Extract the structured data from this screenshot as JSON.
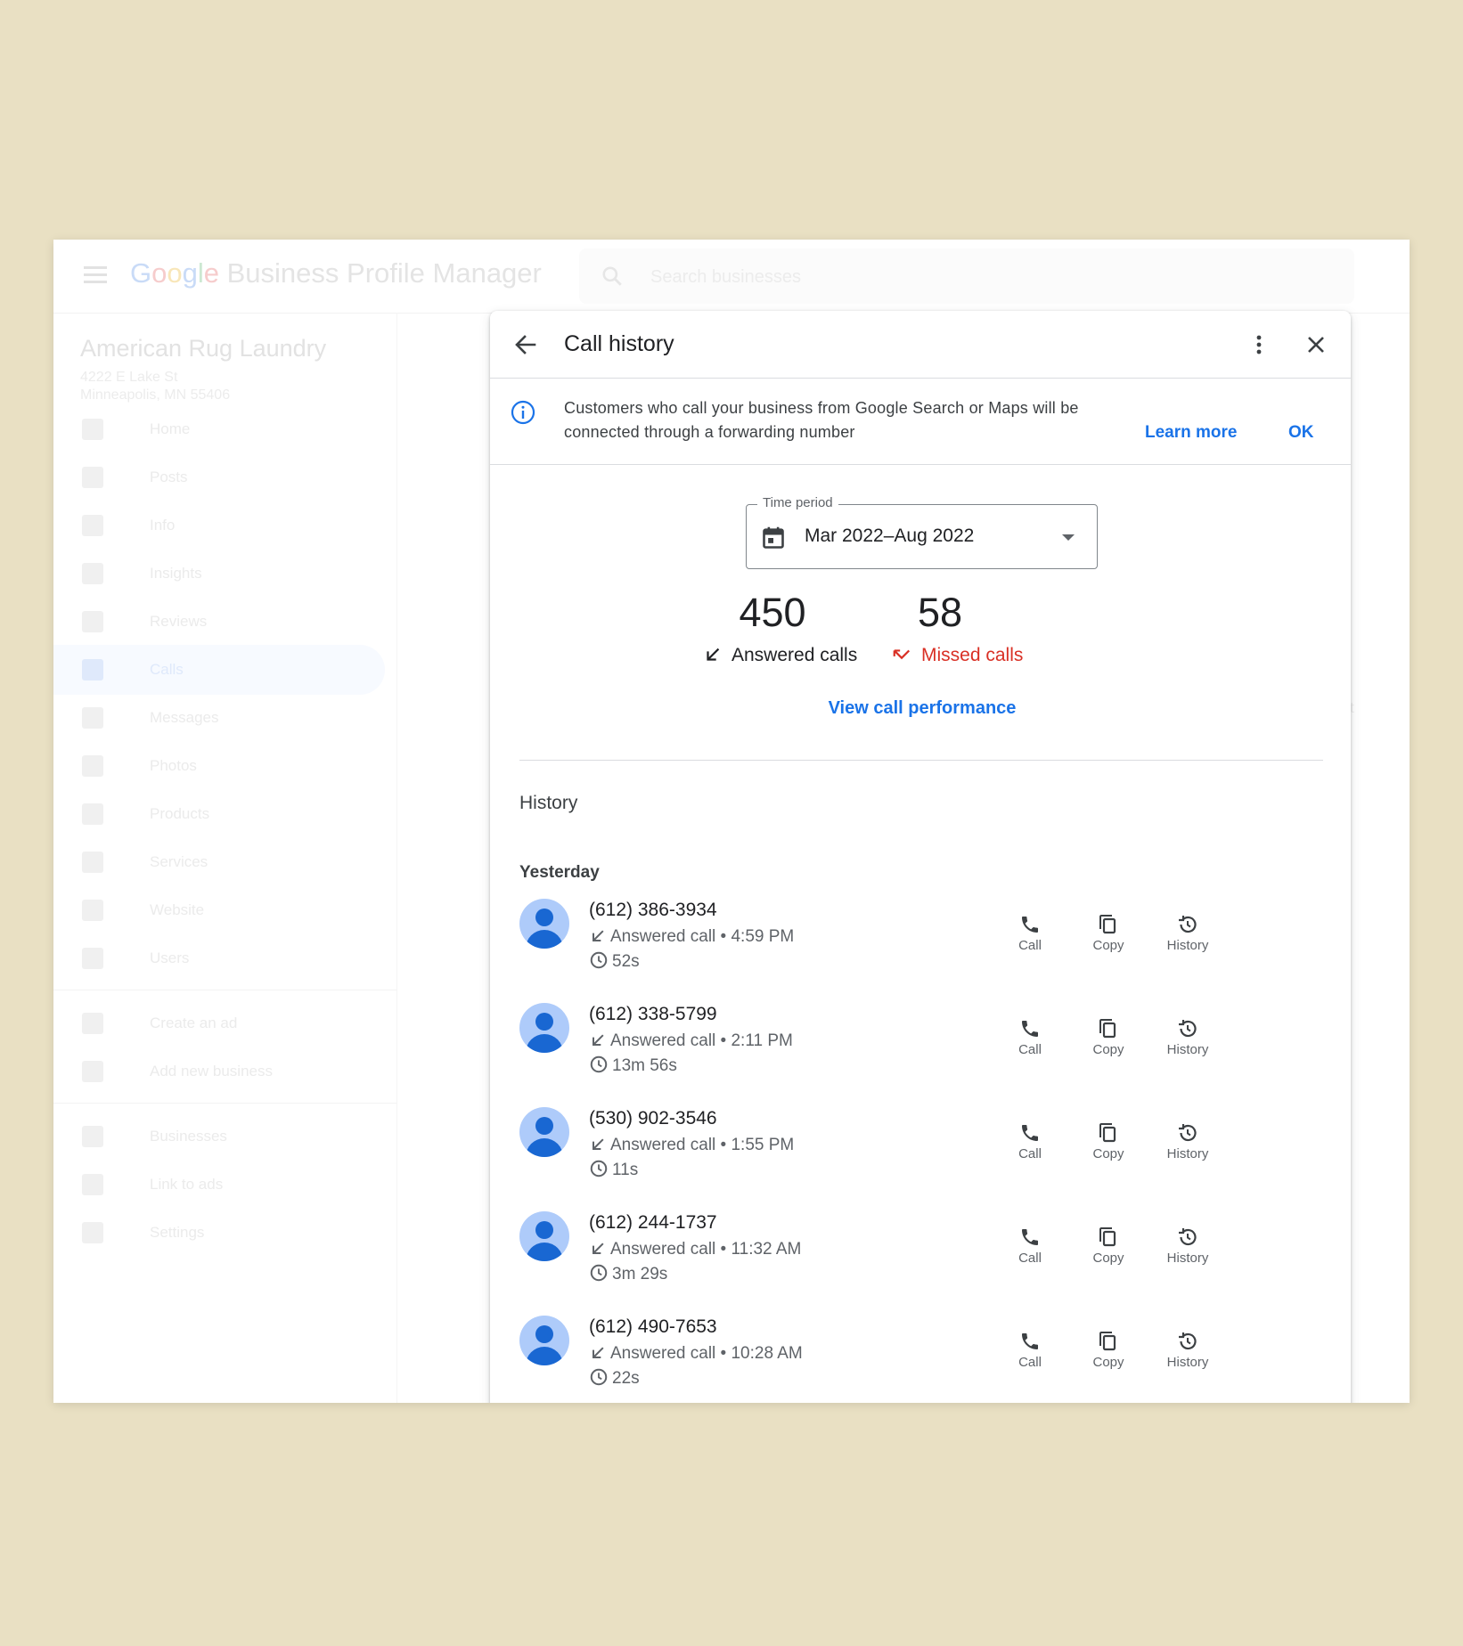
{
  "app": {
    "title_parts": [
      "G",
      "o",
      "o",
      "g",
      "l",
      "e"
    ],
    "title_rest": " Business Profile Manager",
    "search_placeholder": "Search businesses"
  },
  "sidebar": {
    "business_name": "American Rug Laundry",
    "address_line1": "4222 E Lake St",
    "address_line2": "Minneapolis, MN 55406",
    "items": [
      {
        "label": "Home",
        "icon": "home-icon"
      },
      {
        "label": "Posts",
        "icon": "posts-icon"
      },
      {
        "label": "Info",
        "icon": "store-icon"
      },
      {
        "label": "Insights",
        "icon": "bar-chart-icon"
      },
      {
        "label": "Reviews",
        "icon": "reviews-icon"
      },
      {
        "label": "Calls",
        "icon": "phone-icon",
        "active": true
      },
      {
        "label": "Messages",
        "icon": "message-icon"
      },
      {
        "label": "Photos",
        "icon": "photos-icon"
      },
      {
        "label": "Products",
        "icon": "basket-icon"
      },
      {
        "label": "Services",
        "icon": "list-icon"
      },
      {
        "label": "Website",
        "icon": "web-icon"
      },
      {
        "label": "Users",
        "icon": "add-person-icon"
      },
      {
        "label": "Create an ad",
        "icon": "ads-icon"
      },
      {
        "label": "Add new business",
        "icon": "add-location-icon"
      },
      {
        "label": "Businesses",
        "icon": "storefront-icon"
      },
      {
        "label": "Link to ads",
        "icon": "link-icon"
      },
      {
        "label": "Settings",
        "icon": "settings-icon"
      }
    ]
  },
  "background_right_fragment": "t",
  "dialog": {
    "title": "Call history",
    "banner": {
      "text": "Customers who call your business from Google Search or Maps will be connected through a forwarding number",
      "learn_more": "Learn more",
      "ok": "OK"
    },
    "time_period": {
      "label": "Time period",
      "value": "Mar 2022–Aug 2022"
    },
    "stats": {
      "answered_count": "450",
      "answered_label": "Answered calls",
      "missed_count": "58",
      "missed_label": "Missed calls",
      "missed_color": "#d93025"
    },
    "view_performance": "View call performance",
    "history_title": "History",
    "day_label": "Yesterday",
    "action_labels": {
      "call": "Call",
      "copy": "Copy",
      "history": "History"
    },
    "calls": [
      {
        "phone": "(612) 386-3934",
        "status": "Answered call • 4:59 PM",
        "duration": "52s"
      },
      {
        "phone": "(612) 338-5799",
        "status": "Answered call • 2:11 PM",
        "duration": "13m 56s"
      },
      {
        "phone": "(530) 902-3546",
        "status": "Answered call • 1:55 PM",
        "duration": "11s"
      },
      {
        "phone": "(612) 244-1737",
        "status": "Answered call • 11:32 AM",
        "duration": "3m 29s"
      },
      {
        "phone": "(612) 490-7653",
        "status": "Answered call • 10:28 AM",
        "duration": "22s"
      }
    ]
  },
  "colors": {
    "accent": "#1a73e8",
    "avatar_bg": "#aecbfa",
    "avatar_fg": "#1967d2",
    "page_bg": "#e9e0c3"
  }
}
